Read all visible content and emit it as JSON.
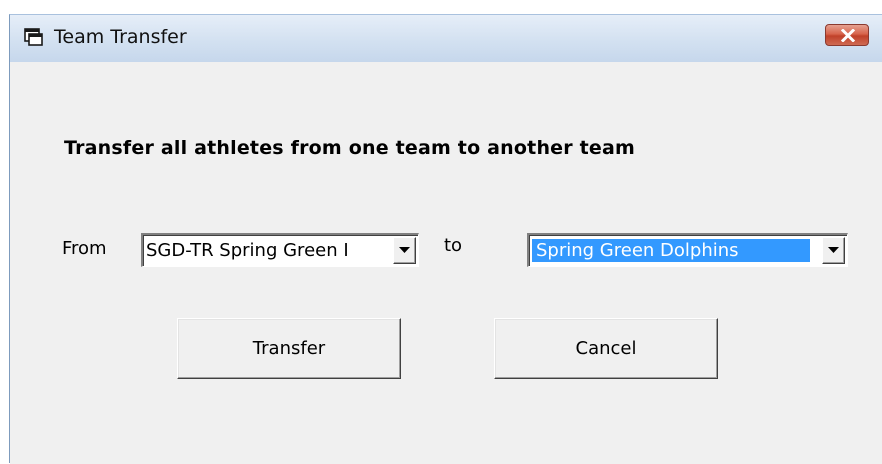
{
  "window": {
    "title": "Team Transfer",
    "close_icon": "close-icon",
    "app_icon": "form-window-icon"
  },
  "form": {
    "heading": "Transfer all athletes from one team to another team",
    "from_label": "From",
    "from_value": "SGD-TR  Spring Green I",
    "to_label": "to",
    "to_value": "Spring Green Dolphins"
  },
  "buttons": {
    "transfer_label": "Transfer",
    "cancel_label": "Cancel"
  },
  "colors": {
    "selection": "#3399ff",
    "close_button": "#c0412a",
    "dialog_background": "#f0f0f0"
  }
}
